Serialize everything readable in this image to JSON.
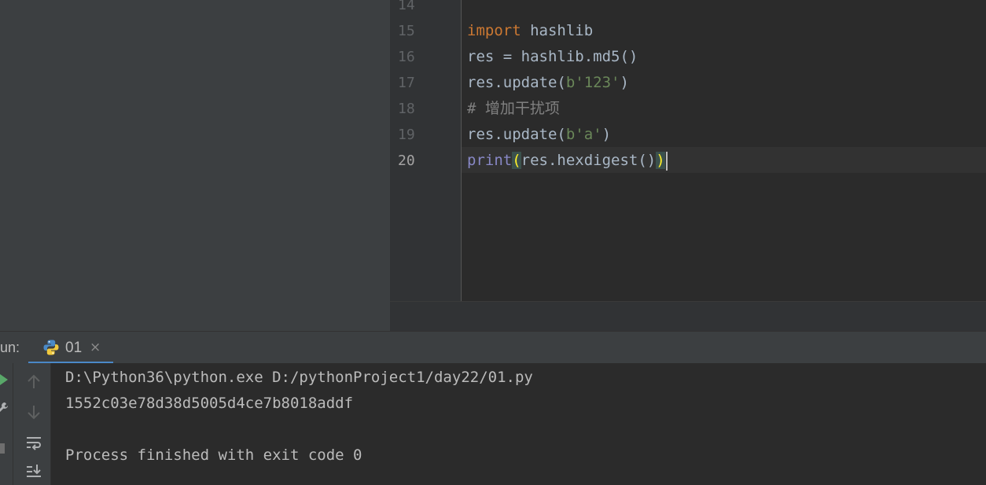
{
  "editor": {
    "line_numbers": [
      "14",
      "15",
      "16",
      "17",
      "18",
      "19",
      "20"
    ],
    "lines": {
      "l15": {
        "kw": "import",
        "rest": " hashlib"
      },
      "l16": {
        "text": "res = hashlib.md5()"
      },
      "l17": {
        "pre": "res.update(",
        "str": "b'123'",
        "post": ")"
      },
      "l18": {
        "comment": "# 增加干扰项"
      },
      "l19": {
        "pre": "res.update(",
        "str": "b'a'",
        "post": ")"
      },
      "l20": {
        "builtin": "print",
        "open_paren": "(",
        "mid": "res.hexdigest()",
        "close_paren": ")"
      }
    }
  },
  "run_panel": {
    "label": "un:",
    "tab": {
      "label": "01",
      "close": "×"
    },
    "output": [
      "D:\\Python36\\python.exe D:/pythonProject1/day22/01.py",
      "1552c03e78d38d5005d4ce7b8018addf",
      "",
      "Process finished with exit code 0"
    ]
  },
  "icons": {
    "tab": "python-icon",
    "toolbar": [
      "run-icon",
      "wrench-icon",
      "stop-icon",
      "scroll-up-icon",
      "scroll-down-icon",
      "soft-wrap-icon",
      "scroll-to-end-icon"
    ]
  },
  "colors": {
    "keyword": "#cc7832",
    "string": "#6a8759",
    "comment": "#808080",
    "builtin": "#8888c6",
    "bracket_match": "#ffef28",
    "run_green": "#59a869",
    "tab_underline": "#4a88c7"
  }
}
